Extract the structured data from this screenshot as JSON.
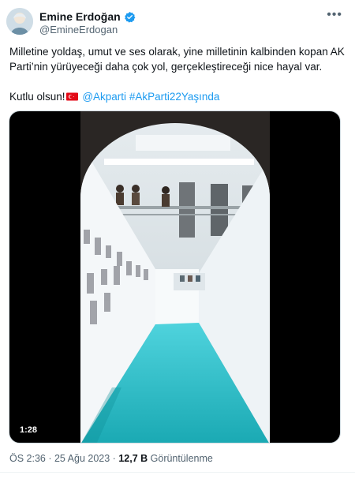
{
  "author": {
    "display_name": "Emine Erdoğan",
    "handle": "@EmineErdogan"
  },
  "tweet": {
    "line1": "Milletine yoldaş, umut ve ses olarak, yine milletinin kalbinden kopan AK Parti’nin yürüyeceği daha çok yol, gerçekleştireceği nice hayal var.",
    "line2_prefix": "Kutlu olsun!",
    "mention": "@Akparti",
    "hashtag": "#AkParti22Yaşında"
  },
  "video": {
    "duration": "1:28"
  },
  "meta": {
    "time": "ÖS 2:36",
    "sep1": " · ",
    "date": "25 Ağu 2023",
    "sep2": " · ",
    "views_count": "12,7 B",
    "views_label": "Görüntülenme"
  },
  "colors": {
    "link": "#1d9bf0",
    "verified": "#1d9bf0",
    "secondary_text": "#536471"
  },
  "icons": {
    "more": "more-horizontal-icon",
    "verified": "verified-badge-icon",
    "flag": "turkey-flag-icon"
  }
}
